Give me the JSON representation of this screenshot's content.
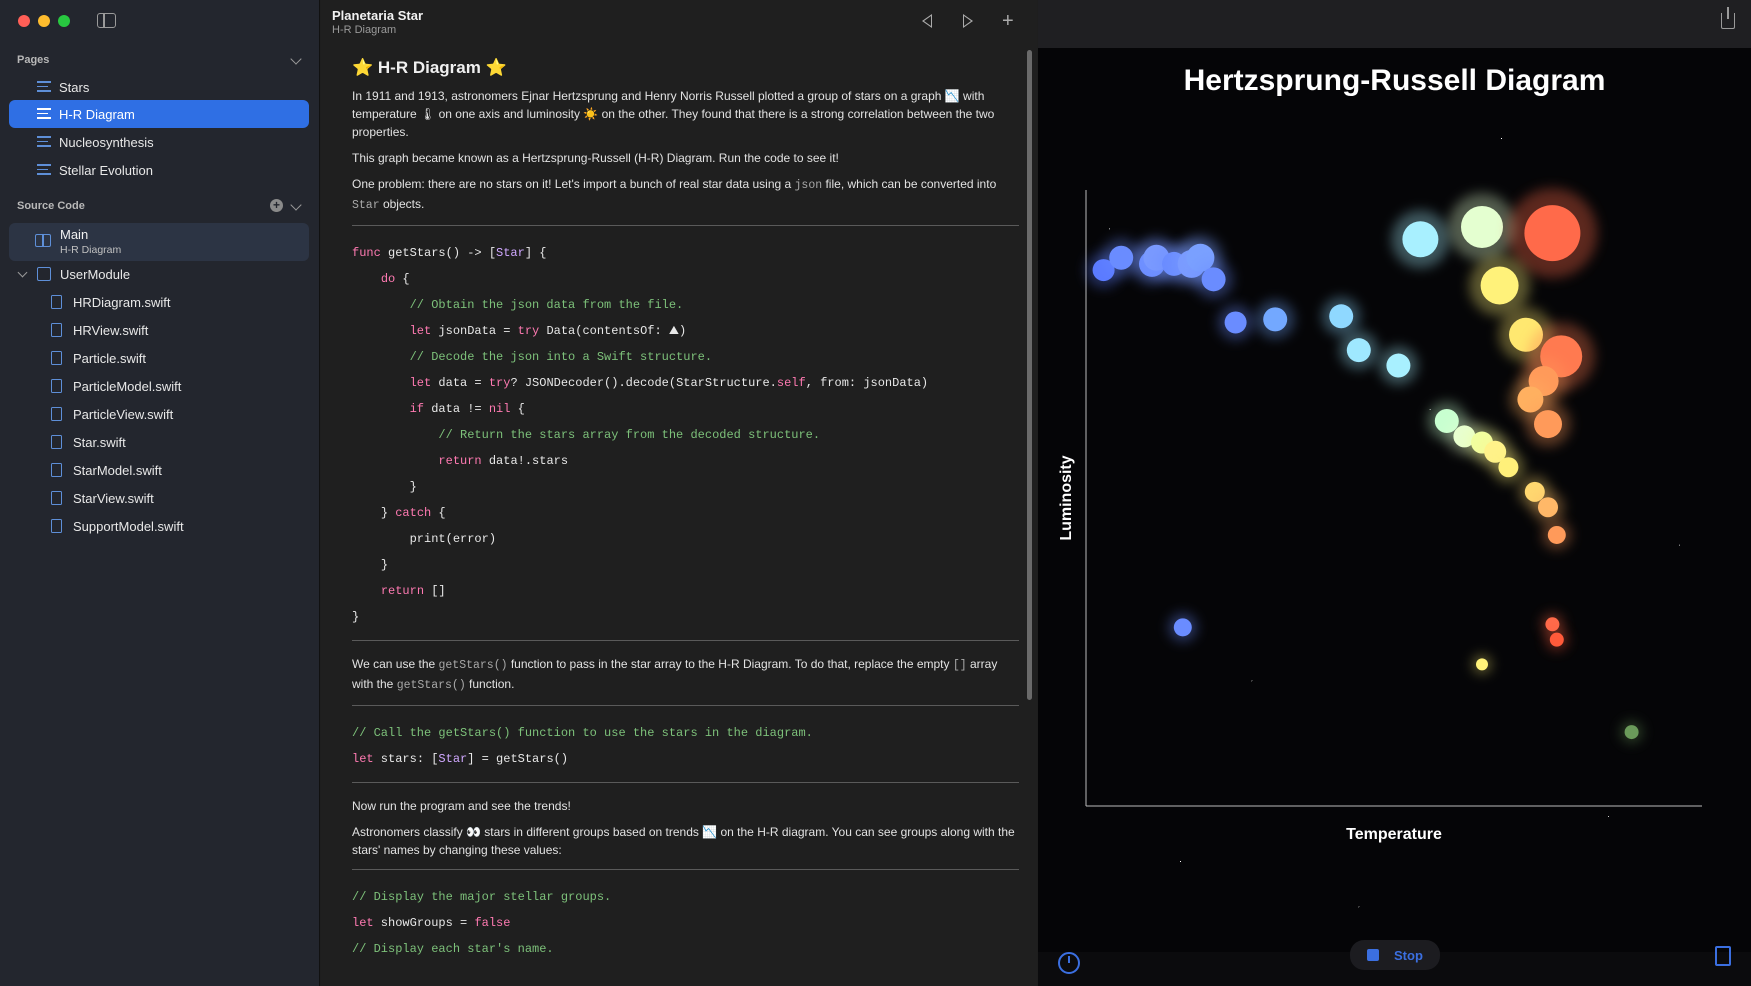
{
  "sidebar": {
    "pages_title": "Pages",
    "pages": [
      {
        "label": "Stars",
        "active": false
      },
      {
        "label": "H-R Diagram",
        "active": true
      },
      {
        "label": "Nucleosynthesis",
        "active": false
      },
      {
        "label": "Stellar Evolution",
        "active": false
      }
    ],
    "source_title": "Source Code",
    "main": {
      "title": "Main",
      "subtitle": "H-R Diagram"
    },
    "module": "UserModule",
    "files": [
      "HRDiagram.swift",
      "HRView.swift",
      "Particle.swift",
      "ParticleModel.swift",
      "ParticleView.swift",
      "Star.swift",
      "StarModel.swift",
      "StarView.swift",
      "SupportModel.swift"
    ]
  },
  "editor": {
    "title": "Planetaria Star",
    "subtitle": "H-R Diagram",
    "heading": "⭐️ H-R Diagram ⭐️",
    "para1": "In 1911 and 1913, astronomers Ejnar Hertzsprung and Henry Norris Russell plotted a group of stars on a graph 📉 with temperature 🌡 on one axis and luminosity ☀️ on the other. They found that there is a strong correlation between the two properties.",
    "para2": "This graph became known as a Hertzsprung-Russell (H-R) Diagram. Run the code to see it!",
    "para3_a": "One problem: there are no stars on it! Let's import a bunch of real star data using a ",
    "para3_json": "json",
    "para3_b": " file, which can be converted into ",
    "para3_star": "Star",
    "para3_c": " objects.",
    "para4_a": "We can use the ",
    "para4_fn": "getStars()",
    "para4_b": " function to pass in the star array to the H-R Diagram. To do that, replace the empty ",
    "para4_empty": "[]",
    "para4_c": " array with the ",
    "para4_fn2": "getStars()",
    "para4_d": " function.",
    "para5": "Now run the program and see the trends!",
    "para6": "Astronomers classify 👀 stars in different groups based on trends 📉 on the H-R diagram. You can see groups along with the stars' names by changing these values:",
    "code": {
      "l1_kw": "func",
      "l1_a": " getStars() -> [",
      "l1_ty": "Star",
      "l1_b": "] {",
      "l2": "do",
      "l3": "// Obtain the json data from the file.",
      "l4_kw": "let",
      "l4_a": " jsonData = ",
      "l4_kw2": "try",
      "l4_b": " Data(contentsOf: ⛰)",
      "l5": "// Decode the json into a Swift structure.",
      "l6_kw": "let",
      "l6_a": " data = ",
      "l6_kw2": "try",
      "l6_b": "? JSONDecoder().decode(StarStructure.",
      "l6_self": "self",
      "l6_c": ", from: jsonData)",
      "l7_kw": "if",
      "l7_a": " data != ",
      "l7_nil": "nil",
      "l7_b": " {",
      "l8": "// Return the stars array from the decoded structure.",
      "l9_kw": "return",
      "l9_a": " data!.stars",
      "l10": "}",
      "l11_a": "} ",
      "l11_kw": "catch",
      "l11_b": " {",
      "l12": "print(error)",
      "l13": "}",
      "l14_kw": "return",
      "l14_a": " []",
      "l15": "}",
      "c2_comment": "// Call the getStars() function to use the stars in the diagram.",
      "c2_kw": "let",
      "c2_a": " stars: [",
      "c2_ty": "Star",
      "c2_b": "] = getStars()",
      "c3_comment1": "// Display the major stellar groups.",
      "c3_kw": "let",
      "c3_a": " showGroups = ",
      "c3_false": "false",
      "c3_comment2": "// Display each star's name."
    }
  },
  "live": {
    "stop_label": "Stop"
  },
  "chart_data": {
    "type": "scatter",
    "title": "Hertzsprung-Russell Diagram",
    "xlabel": "Temperature",
    "ylabel": "Luminosity",
    "points": [
      {
        "x": 2,
        "y": 87,
        "color": "#5b7bff",
        "size": 11
      },
      {
        "x": 4,
        "y": 89,
        "color": "#6a8cff",
        "size": 12
      },
      {
        "x": 7.5,
        "y": 88,
        "color": "#6a8cff",
        "size": 13
      },
      {
        "x": 8,
        "y": 89,
        "color": "#7a9aff",
        "size": 13
      },
      {
        "x": 10,
        "y": 88,
        "color": "#6a8cff",
        "size": 12
      },
      {
        "x": 12,
        "y": 88,
        "color": "#7a9aff",
        "size": 14
      },
      {
        "x": 13,
        "y": 89,
        "color": "#7aa0ff",
        "size": 14
      },
      {
        "x": 14.5,
        "y": 85.5,
        "color": "#6a8cff",
        "size": 12
      },
      {
        "x": 17,
        "y": 78.5,
        "color": "#6a8cff",
        "size": 11
      },
      {
        "x": 21.5,
        "y": 79,
        "color": "#73a8ff",
        "size": 12
      },
      {
        "x": 29,
        "y": 79.5,
        "color": "#8fd8ff",
        "size": 12
      },
      {
        "x": 31,
        "y": 74,
        "color": "#9fe8ff",
        "size": 12
      },
      {
        "x": 35.5,
        "y": 71.5,
        "color": "#a8f0ff",
        "size": 12
      },
      {
        "x": 38,
        "y": 92,
        "color": "#a8f0ff",
        "size": 18
      },
      {
        "x": 45,
        "y": 94,
        "color": "#e4ffd0",
        "size": 21
      },
      {
        "x": 53,
        "y": 93,
        "color": "#ff6a4a",
        "size": 28
      },
      {
        "x": 47,
        "y": 84.5,
        "color": "#fff27a",
        "size": 19
      },
      {
        "x": 50,
        "y": 76.5,
        "color": "#ffe870",
        "size": 17
      },
      {
        "x": 54,
        "y": 73,
        "color": "#ff7a50",
        "size": 21
      },
      {
        "x": 52,
        "y": 69,
        "color": "#ff9a5a",
        "size": 15
      },
      {
        "x": 50.5,
        "y": 66,
        "color": "#ffb060",
        "size": 13
      },
      {
        "x": 52.5,
        "y": 62,
        "color": "#ff9a5a",
        "size": 14
      },
      {
        "x": 41,
        "y": 62.5,
        "color": "#c8ffd0",
        "size": 12
      },
      {
        "x": 43,
        "y": 60,
        "color": "#e8ffd0",
        "size": 11
      },
      {
        "x": 45,
        "y": 59,
        "color": "#f0ffa0",
        "size": 11
      },
      {
        "x": 46.5,
        "y": 57.5,
        "color": "#fff28a",
        "size": 11
      },
      {
        "x": 48,
        "y": 55,
        "color": "#fff07a",
        "size": 10
      },
      {
        "x": 51,
        "y": 51,
        "color": "#ffd870",
        "size": 10
      },
      {
        "x": 52.5,
        "y": 48.5,
        "color": "#ffb868",
        "size": 10
      },
      {
        "x": 53.5,
        "y": 44,
        "color": "#ff9a5a",
        "size": 9
      },
      {
        "x": 11,
        "y": 29,
        "color": "#6a8cff",
        "size": 9
      },
      {
        "x": 53,
        "y": 29.5,
        "color": "#ff6a4a",
        "size": 7
      },
      {
        "x": 53.5,
        "y": 27,
        "color": "#ff5a3a",
        "size": 7
      },
      {
        "x": 45,
        "y": 23,
        "color": "#fff27a",
        "size": 6
      },
      {
        "x": 62,
        "y": 12,
        "color": "#6a9a5a",
        "size": 7
      }
    ]
  }
}
